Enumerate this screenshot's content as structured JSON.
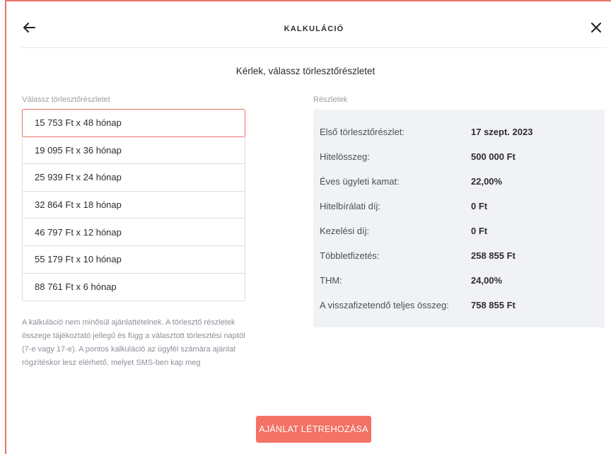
{
  "header": {
    "title": "KALKULÁCIÓ",
    "back_icon": "arrow-left-icon",
    "close_icon": "close-icon"
  },
  "subtitle": "Kérlek, válassz törlesztőrészletet",
  "options_section": {
    "label": "Válassz törlesztőrészletet",
    "selected_index": 0,
    "items": [
      "15 753 Ft x 48 hónap",
      "19 095 Ft x 36 hónap",
      "25 939 Ft x 24 hónap",
      "32 864 Ft x 18 hónap",
      "46 797 Ft x 12 hónap",
      "55 179 Ft x 10 hónap",
      "88 761 Ft x 6 hónap"
    ]
  },
  "details_section": {
    "label": "Részletek",
    "rows": [
      {
        "label": "Első törlesztőrészlet:",
        "value": "17 szept. 2023"
      },
      {
        "label": "Hitelösszeg:",
        "value": "500 000 Ft"
      },
      {
        "label": "Éves ügyleti kamat:",
        "value": "22,00%"
      },
      {
        "label": "Hitelbírálati díj:",
        "value": "0 Ft"
      },
      {
        "label": "Kezelési díj:",
        "value": "0 Ft"
      },
      {
        "label": "Többletfizetés:",
        "value": "258 855 Ft"
      },
      {
        "label": "THM:",
        "value": "24,00%"
      },
      {
        "label": "A visszafizetendő teljes összeg:",
        "value": "758 855 Ft"
      }
    ]
  },
  "note": "A kalkuláció nem minősül ajánlattételnek. A törlesztő részletek összege tájékoztató jellegű és függ a választott törlesztési naptól (7-e vagy 17-e). A pontos kalkuláció az ügyfél számára ajánlat rögzítéskor lesz elérhető, melyet SMS-ben kap meg",
  "cta_label": "AJÁNLAT LÉTREHOZÁSA",
  "colors": {
    "accent": "#f37165",
    "border_accent": "#e9736a",
    "panel_bg": "#f0f2f5"
  }
}
